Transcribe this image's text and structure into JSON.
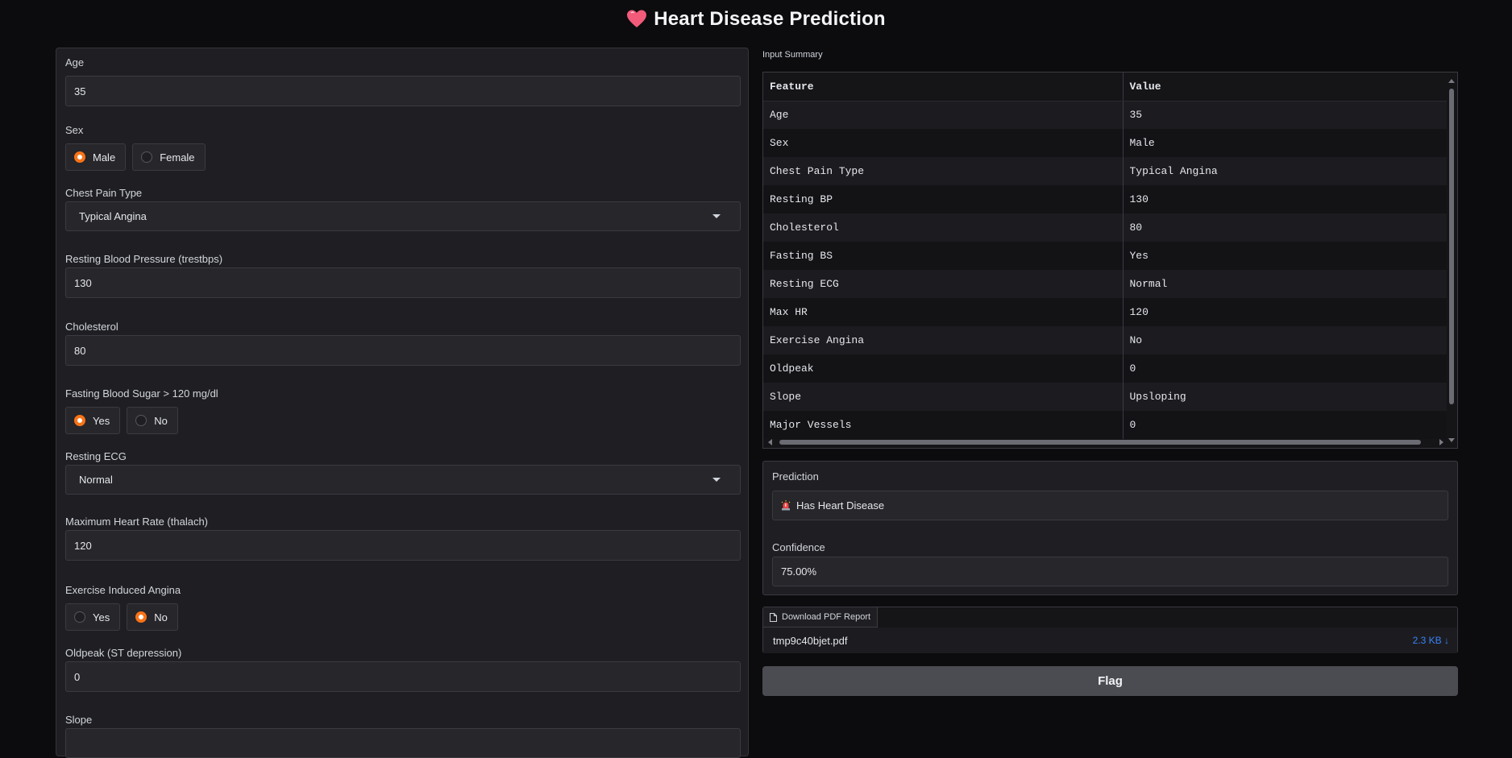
{
  "header": {
    "title": "Heart Disease Prediction",
    "icon": "heart-icon"
  },
  "form": {
    "age": {
      "label": "Age",
      "value": "35"
    },
    "sex": {
      "label": "Sex",
      "options": [
        "Male",
        "Female"
      ],
      "selected": "Male"
    },
    "chest_pain": {
      "label": "Chest Pain Type",
      "value": "Typical Angina"
    },
    "trestbps": {
      "label": "Resting Blood Pressure (trestbps)",
      "value": "130"
    },
    "cholesterol": {
      "label": "Cholesterol",
      "value": "80"
    },
    "fbs": {
      "label": "Fasting Blood Sugar > 120 mg/dl",
      "options": [
        "Yes",
        "No"
      ],
      "selected": "Yes"
    },
    "restecg": {
      "label": "Resting ECG",
      "value": "Normal"
    },
    "thalach": {
      "label": "Maximum Heart Rate (thalach)",
      "value": "120"
    },
    "exang": {
      "label": "Exercise Induced Angina",
      "options": [
        "Yes",
        "No"
      ],
      "selected": "No"
    },
    "oldpeak": {
      "label": "Oldpeak (ST depression)",
      "value": "0"
    },
    "slope": {
      "label": "Slope"
    }
  },
  "summary": {
    "label": "Input Summary",
    "headers": [
      "Feature",
      "Value"
    ],
    "rows": [
      [
        "Age",
        "35"
      ],
      [
        "Sex",
        "Male"
      ],
      [
        "Chest Pain Type",
        "Typical Angina"
      ],
      [
        "Resting BP",
        "130"
      ],
      [
        "Cholesterol",
        "80"
      ],
      [
        "Fasting BS",
        "Yes"
      ],
      [
        "Resting ECG",
        "Normal"
      ],
      [
        "Max HR",
        "120"
      ],
      [
        "Exercise Angina",
        "No"
      ],
      [
        "Oldpeak",
        "0"
      ],
      [
        "Slope",
        "Upsloping"
      ],
      [
        "Major Vessels",
        "0"
      ]
    ]
  },
  "prediction": {
    "label": "Prediction",
    "value": "Has Heart Disease",
    "icon": "alarm-light-icon",
    "confidence_label": "Confidence",
    "confidence_value": "75.00%"
  },
  "download": {
    "label": "Download PDF Report",
    "filename": "tmp9c40bjet.pdf",
    "size": "2.3 KB ↓"
  },
  "flag": {
    "label": "Flag"
  },
  "colors": {
    "accent": "#f97316",
    "link": "#3b82f6",
    "background": "#0c0c0f"
  }
}
